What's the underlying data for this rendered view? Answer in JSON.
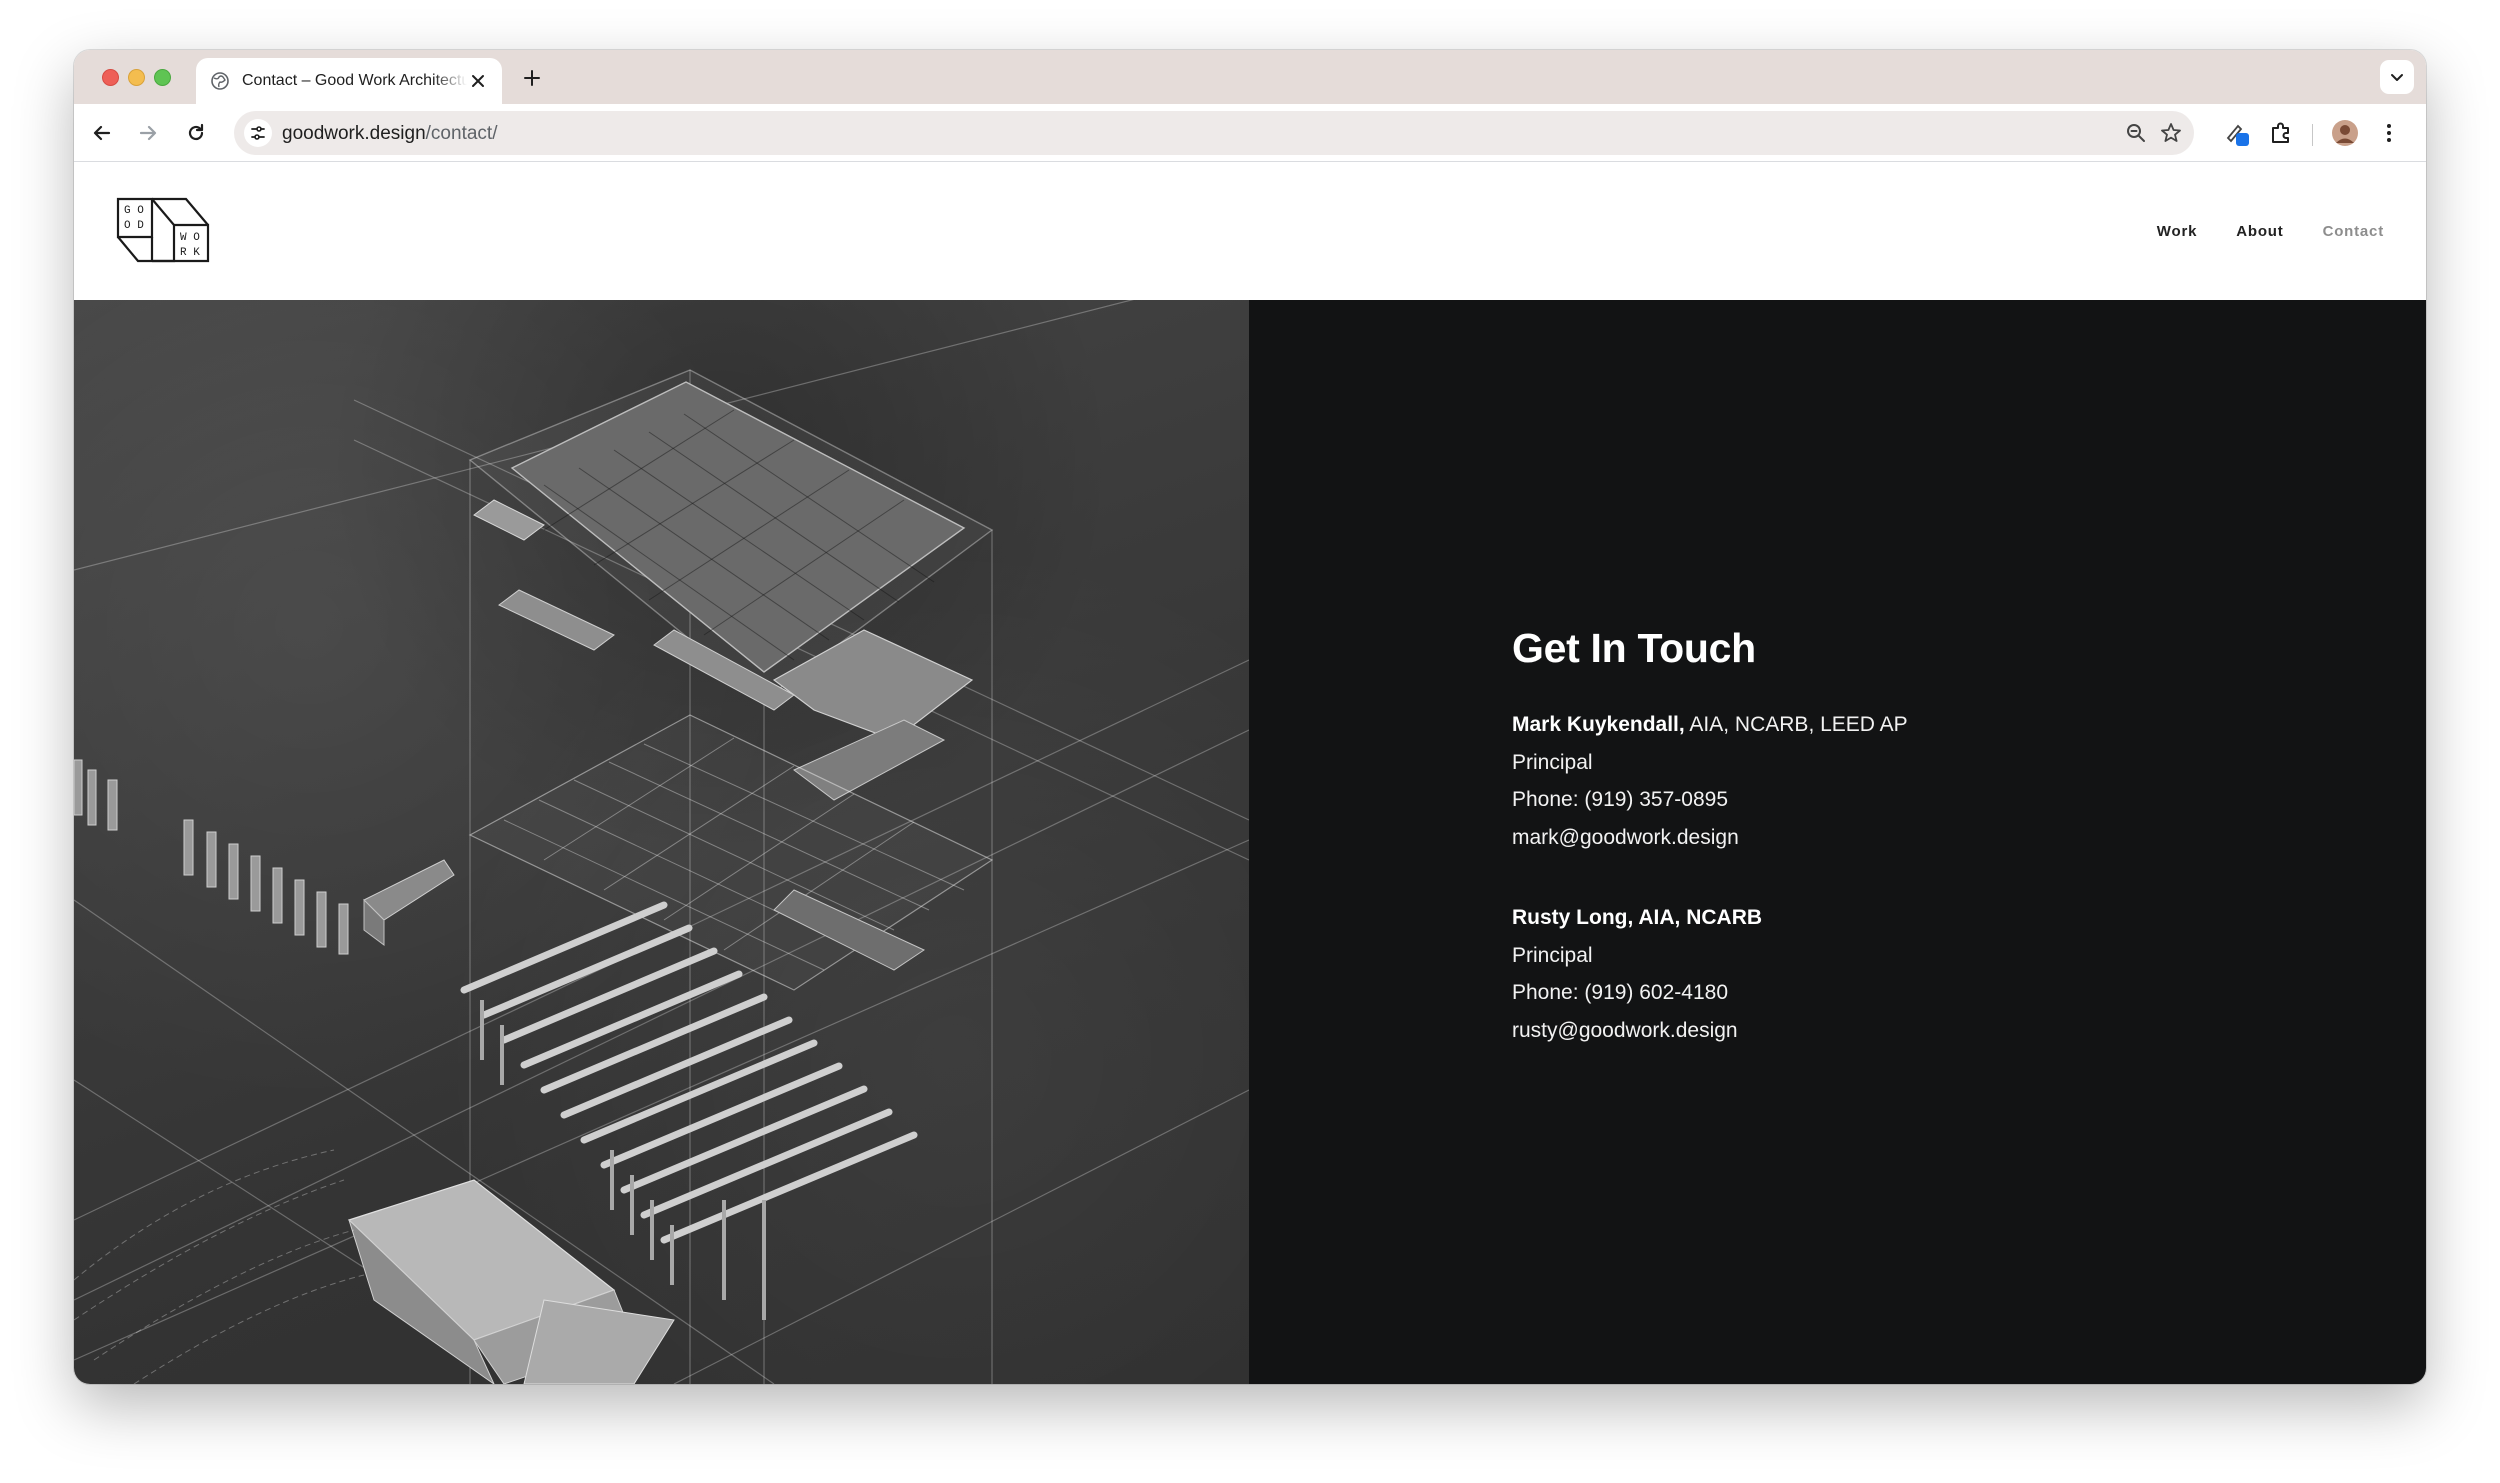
{
  "browser": {
    "tab": {
      "title": "Contact – Good Work Architecture",
      "favicon": "globe-icon"
    },
    "url": {
      "domain": "goodwork.design",
      "path": "/contact/"
    },
    "colors": {
      "tab_strip": "#e5dcd9",
      "omnibox": "#eeeae9",
      "extension_badge": "#1a73e8"
    }
  },
  "site": {
    "logo": {
      "name": "GOOD WORK"
    },
    "nav": [
      {
        "label": "Work"
      },
      {
        "label": "About"
      },
      {
        "label": "Contact",
        "current": true
      }
    ],
    "contact": {
      "heading": "Get In Touch",
      "people": [
        {
          "name": "Mark Kuykendall,",
          "credentials": " AIA, NCARB, LEED AP",
          "role": "Principal",
          "phone": "Phone: (919) 357-0895",
          "email": "mark@goodwork.design"
        },
        {
          "name": "Rusty Long, AIA, NCARB",
          "credentials": "",
          "role": "Principal",
          "phone": "Phone: (919) 602-4180",
          "email": "rusty@goodwork.design"
        }
      ]
    },
    "colors": {
      "dark_panel": "#121314",
      "nav_current": "#8d8d8d"
    }
  }
}
